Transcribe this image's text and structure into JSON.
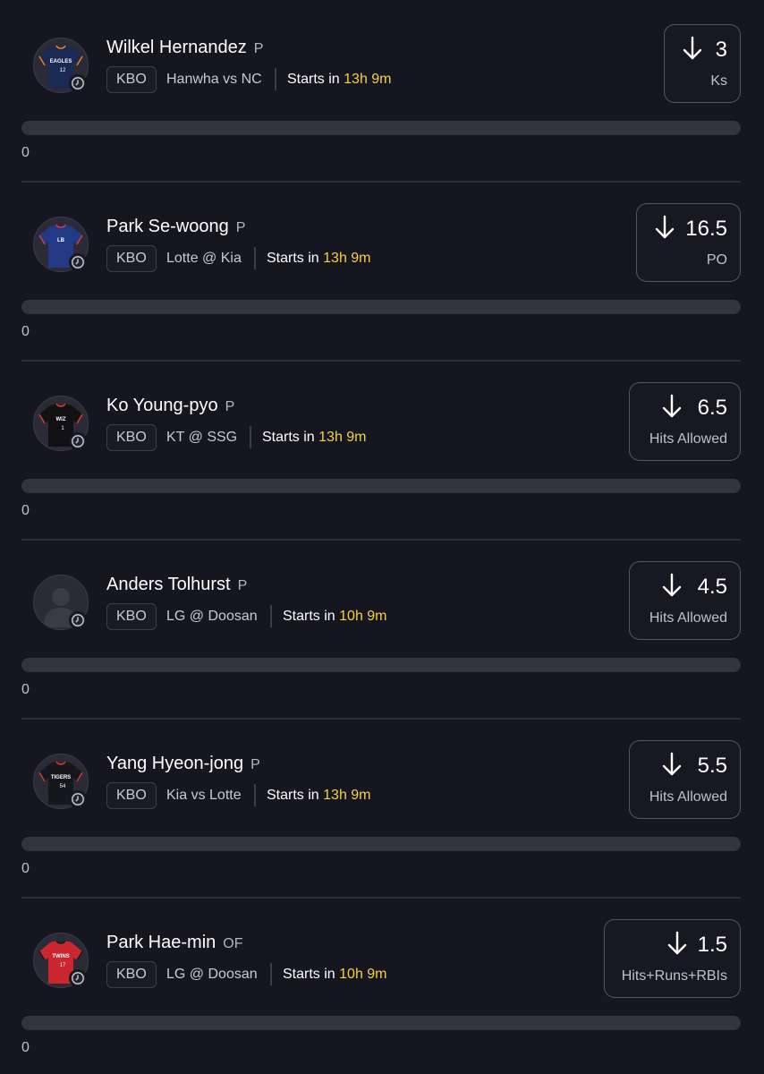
{
  "players": [
    {
      "name": "Wilkel Hernandez",
      "position": "P",
      "league": "KBO",
      "team": "Hanwha",
      "connector": "vs",
      "opponent": "NC",
      "starts_prefix": "Starts in",
      "starts_time": "13h 9m",
      "line": "3",
      "stat": "Ks",
      "direction": "down",
      "progress": 0,
      "progress_label": "0",
      "jersey": {
        "base": "#1b2a55",
        "trim": "#f07c1e",
        "text": "EAGLES",
        "number": "12"
      }
    },
    {
      "name": "Park Se-woong",
      "position": "P",
      "league": "KBO",
      "team": "Lotte",
      "connector": "@",
      "opponent": "Kia",
      "starts_prefix": "Starts in",
      "starts_time": "13h 9m",
      "line": "16.5",
      "stat": "PO",
      "direction": "down",
      "progress": 0,
      "progress_label": "0",
      "jersey": {
        "base": "#223a86",
        "trim": "#d83a3a",
        "text": "LB",
        "number": ""
      }
    },
    {
      "name": "Ko Young-pyo",
      "position": "P",
      "league": "KBO",
      "team": "KT",
      "connector": "@",
      "opponent": "SSG",
      "starts_prefix": "Starts in",
      "starts_time": "13h 9m",
      "line": "6.5",
      "stat": "Hits Allowed",
      "direction": "down",
      "progress": 0,
      "progress_label": "0",
      "jersey": {
        "base": "#111114",
        "trim": "#e2352f",
        "text": "WIZ",
        "number": "1"
      }
    },
    {
      "name": "Anders Tolhurst",
      "position": "P",
      "league": "KBO",
      "team": "LG",
      "connector": "@",
      "opponent": "Doosan",
      "starts_prefix": "Starts in",
      "starts_time": "10h 9m",
      "line": "4.5",
      "stat": "Hits Allowed",
      "direction": "down",
      "progress": 0,
      "progress_label": "0",
      "jersey": null
    },
    {
      "name": "Yang Hyeon-jong",
      "position": "P",
      "league": "KBO",
      "team": "Kia",
      "connector": "vs",
      "opponent": "Lotte",
      "starts_prefix": "Starts in",
      "starts_time": "13h 9m",
      "line": "5.5",
      "stat": "Hits Allowed",
      "direction": "down",
      "progress": 0,
      "progress_label": "0",
      "jersey": {
        "base": "#16171c",
        "trim": "#d8342c",
        "text": "TIGERS",
        "number": "54"
      }
    },
    {
      "name": "Park Hae-min",
      "position": "OF",
      "league": "KBO",
      "team": "LG",
      "connector": "@",
      "opponent": "Doosan",
      "starts_prefix": "Starts in",
      "starts_time": "10h 9m",
      "line": "1.5",
      "stat": "Hits+Runs+RBIs",
      "direction": "down",
      "progress": 0,
      "progress_label": "0",
      "jersey": {
        "base": "#c9262e",
        "trim": "#1a1a1a",
        "text": "TWINS",
        "number": "17"
      }
    }
  ],
  "colors": {
    "background": "#161620",
    "accent_time": "#f7d23f",
    "card_border": "#55555f",
    "bar_track": "#34343f"
  },
  "icons": {
    "direction": "arrow-down-icon",
    "status": "clock-icon",
    "avatar": "jersey-icon"
  }
}
